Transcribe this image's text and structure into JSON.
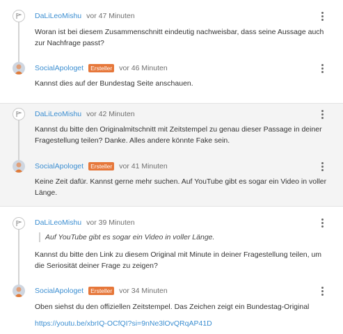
{
  "comments": [
    {
      "user": "DaLiLeoMishu",
      "time": "vor 47 Minuten",
      "is_author": false,
      "badge": "",
      "text": "Woran ist bei diesem Zusammenschnitt eindeutig nachweisbar, dass seine Aussage auch zur Nachfrage passt?"
    },
    {
      "user": "SocialApologet",
      "time": "vor 46 Minuten",
      "is_author": true,
      "badge": "Ersteller",
      "text": "Kannst dies auf der Bundestag Seite anschauen."
    },
    {
      "user": "DaLiLeoMishu",
      "time": "vor 42 Minuten",
      "is_author": false,
      "badge": "",
      "text": "Kannst du bitte den Originalmitschnitt mit Zeitstempel zu genau dieser Passage in deiner Fragestellung teilen? Danke. Alles andere könnte Fake sein."
    },
    {
      "user": "SocialApologet",
      "time": "vor 41 Minuten",
      "is_author": true,
      "badge": "Ersteller",
      "text": "Keine Zeit dafür. Kannst gerne mehr suchen. Auf YouTube gibt es sogar ein Video in voller Länge."
    },
    {
      "user": "DaLiLeoMishu",
      "time": "vor 39 Minuten",
      "is_author": false,
      "badge": "",
      "quote": "Auf YouTube gibt es sogar ein Video in voller Länge.",
      "text": "Kannst du bitte den Link zu diesem Original mit Minute in deiner Fragestellung teilen, um die Seriosität deiner Frage zu zeigen?"
    },
    {
      "user": "SocialApologet",
      "time": "vor 34 Minuten",
      "is_author": true,
      "badge": "Ersteller",
      "text": "Oben siehst du den offiziellen Zeitstempel. Das Zeichen zeigt ein Bundestag-Original",
      "link": "https://youtu.be/xbrIQ-OCfQI?si=9nNe3lOvQRqAP41D"
    }
  ],
  "colors": {
    "link": "#3b8ed1",
    "badge": "#e6773a",
    "grey_background": "#f4f4f4"
  },
  "icons": {
    "question_avatar": "flag-icon",
    "author_avatar": "person-icon",
    "menu": "more-vertical-icon"
  }
}
